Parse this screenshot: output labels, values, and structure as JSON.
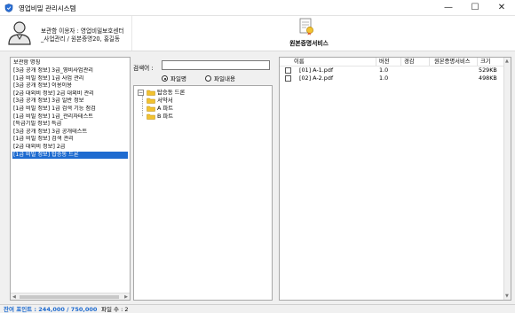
{
  "window": {
    "title": "영업비밀 관리시스템",
    "min_glyph": "—",
    "max_glyph": "☐",
    "close_glyph": "✕",
    "app_icon": "shield-icon"
  },
  "header": {
    "user_line1": "보관함 이용자 : 영업비밀보호센터",
    "user_line2": "_사업관리 / 원본증명20, 홍길동",
    "service_button_label": "원본증명서비스",
    "user_icon": "user-icon",
    "service_icon": "certificate-icon"
  },
  "case_list": {
    "header": "보관함 명칭",
    "items": [
      "[3급 공개 정보] 3급_영비사업관리",
      "[1급 비밀 정보] 1급 사업 관리",
      "[3급 공개 정보] 이용이용",
      "[2급 대외비 정보] 2급 대외비 관리",
      "[3급 공개 정보] 3급 일반 정보",
      "[1급 비밀 정보] 1급 검색 기능 점검",
      "[1급 비밀 정보] 1급_관리자테스트",
      "[특급기밀 정보] 특급",
      "[3급 공개 정보] 3급 공개테스트",
      "[1급 비밀 정보] 검색 관리",
      "[2급 대외비 정보] 2급",
      "[1급 비밀 정보] 탑승동 드론"
    ],
    "selected_index": 11,
    "scroll_left": "◀",
    "scroll_right": "▶"
  },
  "search": {
    "label": "검색어 :",
    "value": "",
    "radio_filename": "파일명",
    "radio_content": "파일내용",
    "selected": "파일명"
  },
  "tree": {
    "root": "탑승동 드론",
    "children": [
      "서약서",
      "A 파트",
      "B 파트"
    ],
    "expand_glyph": "−"
  },
  "files": {
    "columns": [
      "이름",
      "버전",
      "경감",
      "원본증명서비스",
      "크기"
    ],
    "rows": [
      {
        "name": "[01] A-1.pdf",
        "version": "1.0",
        "reduction": "",
        "certificate": "",
        "size": "529KB"
      },
      {
        "name": "[02] A-2.pdf",
        "version": "1.0",
        "reduction": "",
        "certificate": "",
        "size": "498KB"
      }
    ],
    "scroll_up": "▲",
    "scroll_down": "▼"
  },
  "status": {
    "points": "잔여 포인트 : 244,000 / 750,000",
    "file_count": "파일 수 : 2"
  },
  "colors": {
    "selection": "#1e6bd0",
    "folder": "#f2c230",
    "background": "#f0f0f0"
  }
}
